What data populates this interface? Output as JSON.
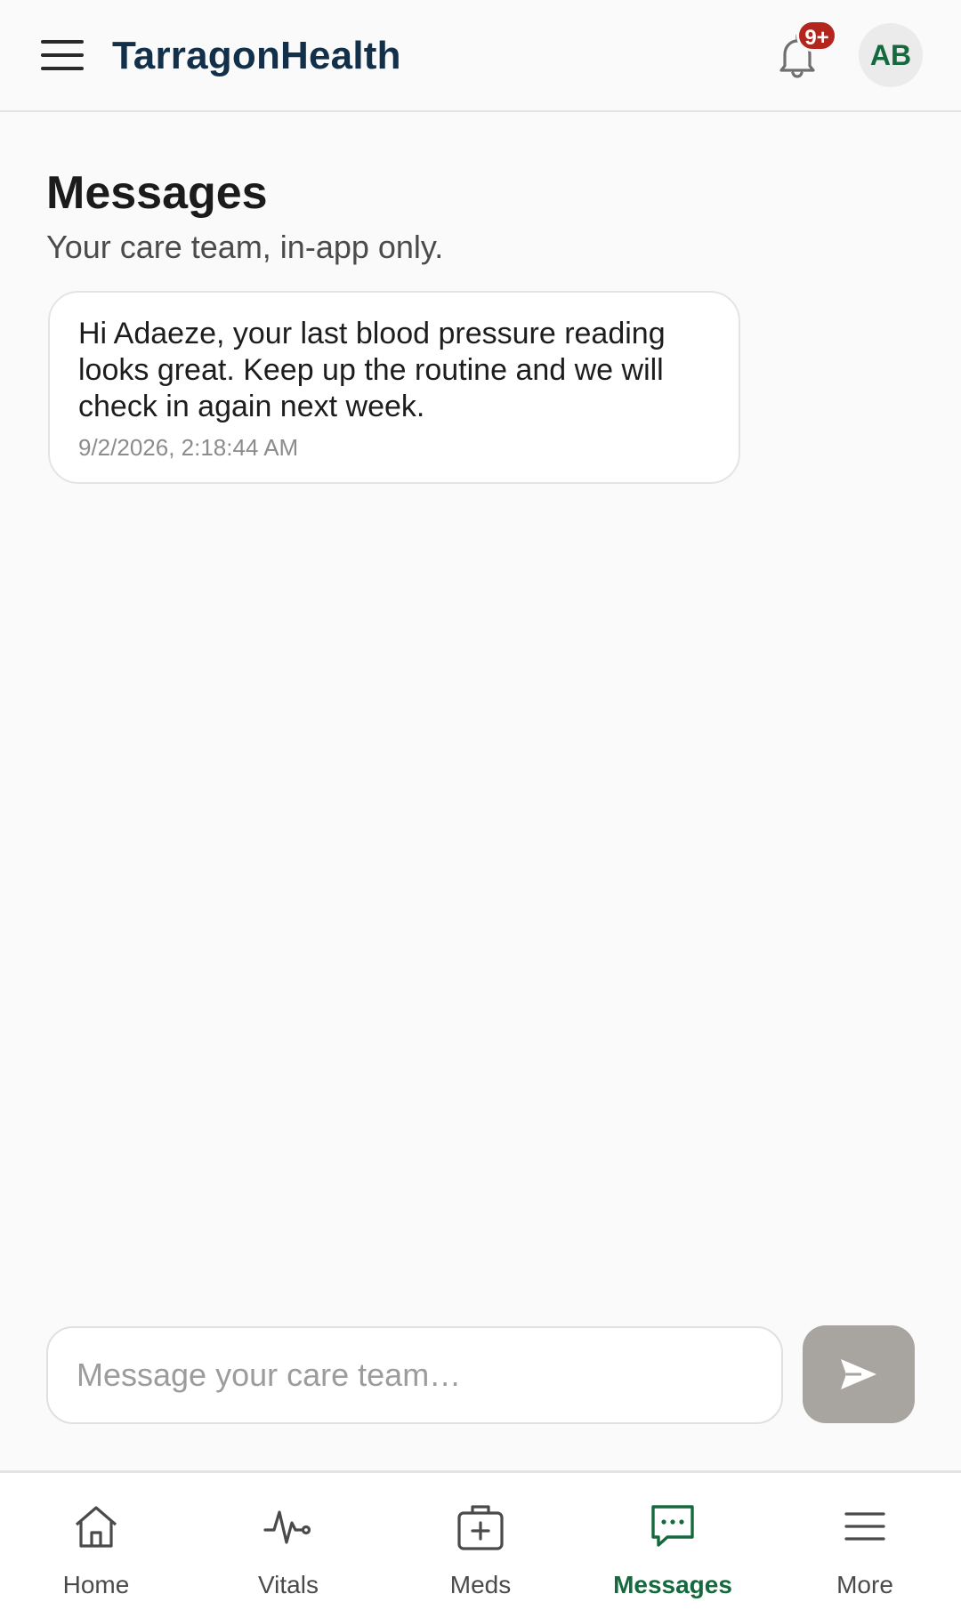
{
  "header": {
    "brand": "TarragonHealth",
    "notification_badge": "9+",
    "avatar_initials": "AB"
  },
  "page": {
    "title": "Messages",
    "subtitle": "Your care team, in-app only."
  },
  "messages": [
    {
      "text": "Hi Adaeze, your last blood pressure reading looks great. Keep up the routine and we will check in again next week.",
      "timestamp": "9/2/2026, 2:18:44 AM"
    }
  ],
  "composer": {
    "placeholder": "Message your care team…"
  },
  "nav": {
    "items": [
      {
        "label": "Home",
        "icon": "home-icon"
      },
      {
        "label": "Vitals",
        "icon": "pulse-icon"
      },
      {
        "label": "Meds",
        "icon": "medkit-icon"
      },
      {
        "label": "Messages",
        "icon": "chat-icon",
        "active": true
      },
      {
        "label": "More",
        "icon": "menu-icon"
      }
    ]
  },
  "colors": {
    "brand": "#13304a",
    "accent": "#16693f",
    "badge": "#b3261e",
    "send_disabled": "#a8a49f"
  }
}
